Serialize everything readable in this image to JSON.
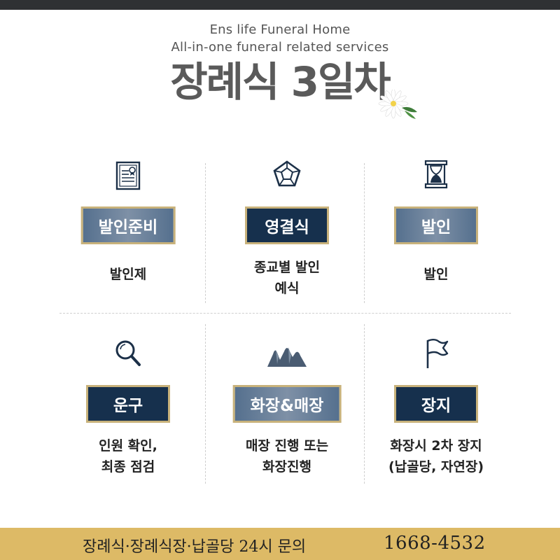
{
  "header": {
    "subtitle_en": "Ens life Funeral Home",
    "subtitle_en2": "All-in-one funeral related services",
    "title": "장례식 3일차"
  },
  "steps": [
    {
      "icon": "certificate-icon",
      "label": "발인준비",
      "style": "gray",
      "desc": [
        "발인제"
      ]
    },
    {
      "icon": "pentagon-gem-icon",
      "label": "영결식",
      "style": "navy",
      "desc": [
        "종교별 발인",
        "예식"
      ]
    },
    {
      "icon": "hourglass-icon",
      "label": "발인",
      "style": "gray",
      "desc": [
        "발인"
      ]
    },
    {
      "icon": "magnifier-icon",
      "label": "운구",
      "style": "navy",
      "desc": [
        "인원 확인,",
        "최종 점검"
      ]
    },
    {
      "icon": "mountain-icon",
      "label": "화장&매장",
      "style": "gray",
      "desc": [
        "매장 진행 또는",
        "화장진행"
      ]
    },
    {
      "icon": "flag-icon",
      "label": "장지",
      "style": "navy",
      "desc": [
        "화장시 2차 장지",
        "(납골당, 자연장)"
      ]
    }
  ],
  "footer": {
    "text": "장례식·장례식장·납골당 24시 문의",
    "phone": "1668-4532"
  },
  "colors": {
    "navy": "#16304d",
    "gray_blue": "#6a8099",
    "gold": "#ddba66",
    "border_gold": "#c8b27b"
  }
}
